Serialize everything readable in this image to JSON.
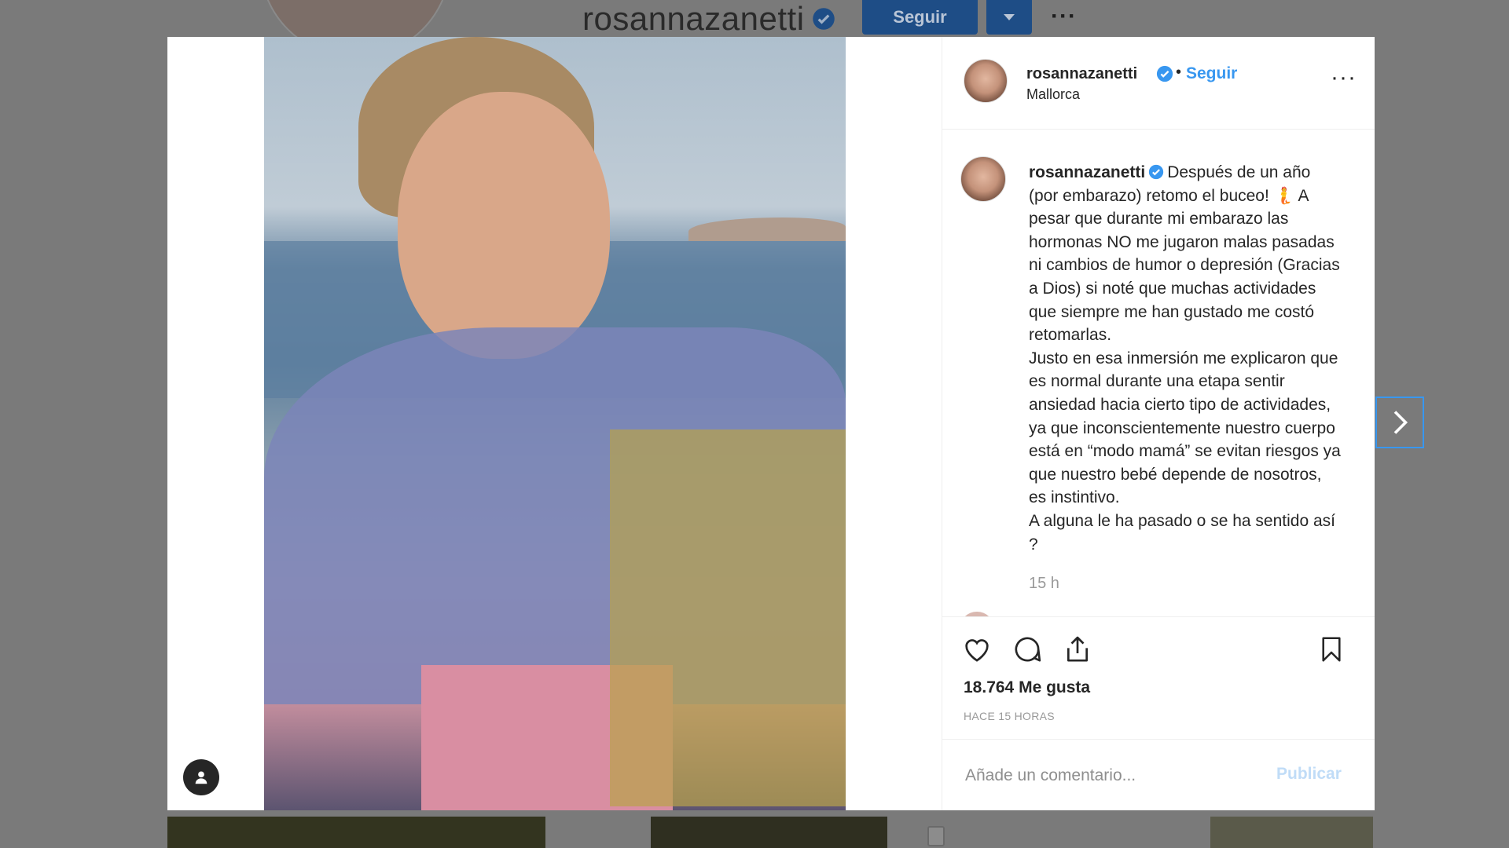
{
  "background": {
    "username": "rosannazanetti",
    "follow_label": "Seguir",
    "more_label": "···"
  },
  "post": {
    "username": "rosannazanetti",
    "dot": "•",
    "follow_label": "Seguir",
    "location": "Mallorca",
    "more_label": "···",
    "caption_text": "Después de un año (por embarazo) retomo el buceo! 🧜 A pesar que durante mi embarazo las hormonas NO me jugaron malas pasadas ni cambios de humor o depresión (Gracias a Dios) si noté que muchas actividades que siempre me han gustado me costó retomarlas.",
    "caption_text2": "Justo en esa inmersión me explicaron que es normal durante una etapa sentir ansiedad hacia cierto tipo de actividades, ya que inconscientemente nuestro cuerpo está en “modo mamá” se evitan riesgos ya que nuestro bebé depende de nosotros, es instintivo.",
    "caption_text3": "A alguna le ha pasado o se ha sentido así ?",
    "time_small": "15 h",
    "likes_count": "18.764",
    "likes_label": "Me gusta",
    "posted_time": "HACE 15 HORAS"
  },
  "comment": {
    "placeholder": "Añade un comentario...",
    "publish_label": "Publicar"
  },
  "icons": {
    "verified": "verified-badge-icon",
    "like": "heart-icon",
    "comment": "comment-bubble-icon",
    "share": "share-icon",
    "save": "bookmark-icon",
    "tag": "user-tag-icon",
    "next": "chevron-right-icon"
  },
  "colors": {
    "accent": "#3897f0",
    "text": "#262626",
    "muted": "#999999",
    "overlay": "#7a7a7a"
  }
}
